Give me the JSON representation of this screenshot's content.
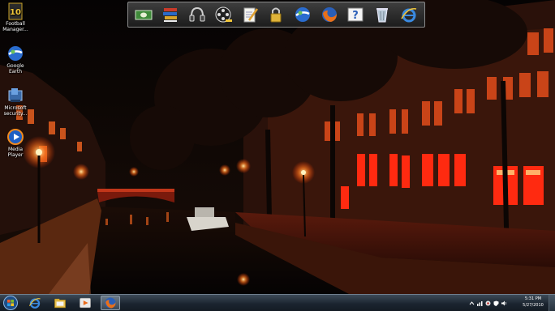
{
  "desktop": {
    "icons": [
      {
        "label": "Football Manager...",
        "icon": "football-manager-icon"
      },
      {
        "label": "Google Earth",
        "icon": "google-earth-icon"
      },
      {
        "label": "Microsoft security...",
        "icon": "microsoft-security-icon"
      },
      {
        "label": "Media Player",
        "icon": "media-player-icon"
      }
    ]
  },
  "dock": {
    "items": [
      {
        "icon": "cash-icon"
      },
      {
        "icon": "book-stack-icon"
      },
      {
        "icon": "headphones-icon"
      },
      {
        "icon": "film-reel-icon"
      },
      {
        "icon": "notepad-pencil-icon"
      },
      {
        "icon": "padlock-icon"
      },
      {
        "icon": "google-earth-icon"
      },
      {
        "icon": "firefox-icon"
      },
      {
        "icon": "help-icon"
      },
      {
        "icon": "recycle-bin-icon"
      },
      {
        "icon": "internet-explorer-icon"
      }
    ]
  },
  "taskbar": {
    "pinned": [
      {
        "icon": "internet-explorer-icon"
      },
      {
        "icon": "explorer-folder-icon"
      },
      {
        "icon": "media-player-icon"
      },
      {
        "icon": "firefox-icon",
        "active": true
      }
    ],
    "tray": {
      "icons": [
        "chevron-up-icon",
        "network-icon",
        "antivirus-icon",
        "shield-icon",
        "volume-icon"
      ],
      "time": "5:31 PM",
      "date": "5/27/2010"
    }
  },
  "colors": {
    "taskbar": "#1b2530",
    "dock": "#2a2a2a",
    "street_light": "#ff5a14"
  }
}
